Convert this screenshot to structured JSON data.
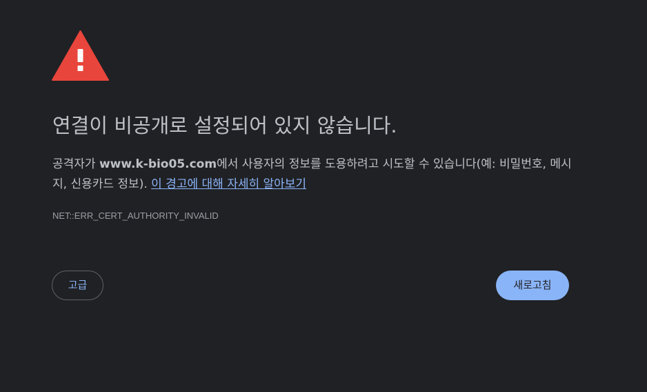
{
  "icons": {
    "warning": "warning-triangle-icon"
  },
  "colors": {
    "background": "#202124",
    "text": "#bdc1c6",
    "secondary_text": "#9aa0a6",
    "link": "#8ab4f8",
    "warning_red": "#e8453c",
    "button_border": "#5f6368",
    "primary_button_bg": "#8ab4f8",
    "primary_button_text": "#202124"
  },
  "heading": "연결이 비공개로 설정되어 있지 않습니다.",
  "explanation": {
    "prefix": "공격자가 ",
    "domain": "www.k-bio05.com",
    "suffix": "에서 사용자의 정보를 도용하려고 시도할 수 있습니다(예: 비밀번호, 메시지, 신용카드 정보). ",
    "link_label": "이 경고에 대해 자세히 알아보기"
  },
  "error_code": "NET::ERR_CERT_AUTHORITY_INVALID",
  "buttons": {
    "advanced_label": "고급",
    "reload_label": "새로고침"
  }
}
